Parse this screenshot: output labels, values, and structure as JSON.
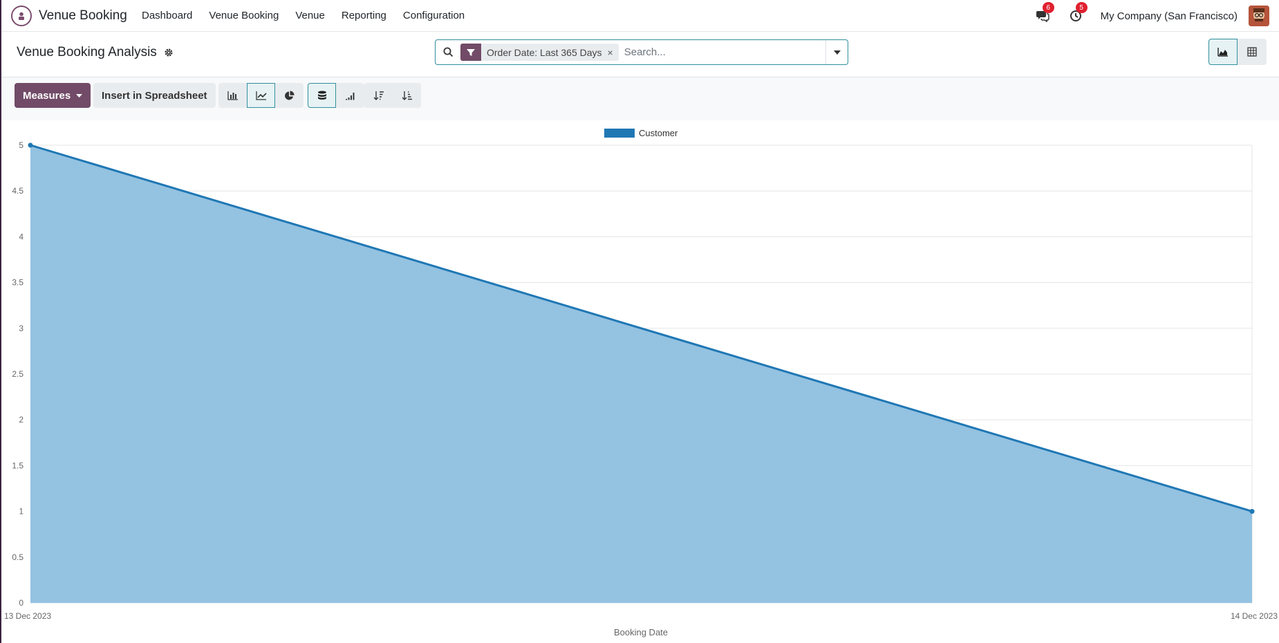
{
  "navbar": {
    "app_name": "Venue Booking",
    "menu": [
      "Dashboard",
      "Venue Booking",
      "Venue",
      "Reporting",
      "Configuration"
    ],
    "messages_badge": "6",
    "activities_badge": "5",
    "company": "My Company (San Francisco)"
  },
  "control": {
    "title": "Venue Booking Analysis",
    "facet_label": "Order Date: Last 365 Days",
    "facet_close": "×",
    "search_placeholder": "Search..."
  },
  "toolbar": {
    "measures_label": "Measures",
    "spreadsheet_label": "Insert in Spreadsheet"
  },
  "colors": {
    "brand": "#714b67",
    "accent": "#2f8f9d",
    "series_line": "#1f77b4",
    "series_fill": "#94c2e1"
  },
  "chart_data": {
    "type": "area",
    "x": [
      "13 Dec 2023",
      "14 Dec 2023"
    ],
    "series": [
      {
        "name": "Customer",
        "values": [
          5,
          1
        ]
      }
    ],
    "xlabel": "Booking Date",
    "ylabel": "",
    "ylim": [
      0,
      5
    ],
    "yticks": [
      "0",
      "0.5",
      "1",
      "1.5",
      "2",
      "2.5",
      "3",
      "3.5",
      "4",
      "4.5",
      "5"
    ],
    "grid": true,
    "legend": "top-center"
  }
}
